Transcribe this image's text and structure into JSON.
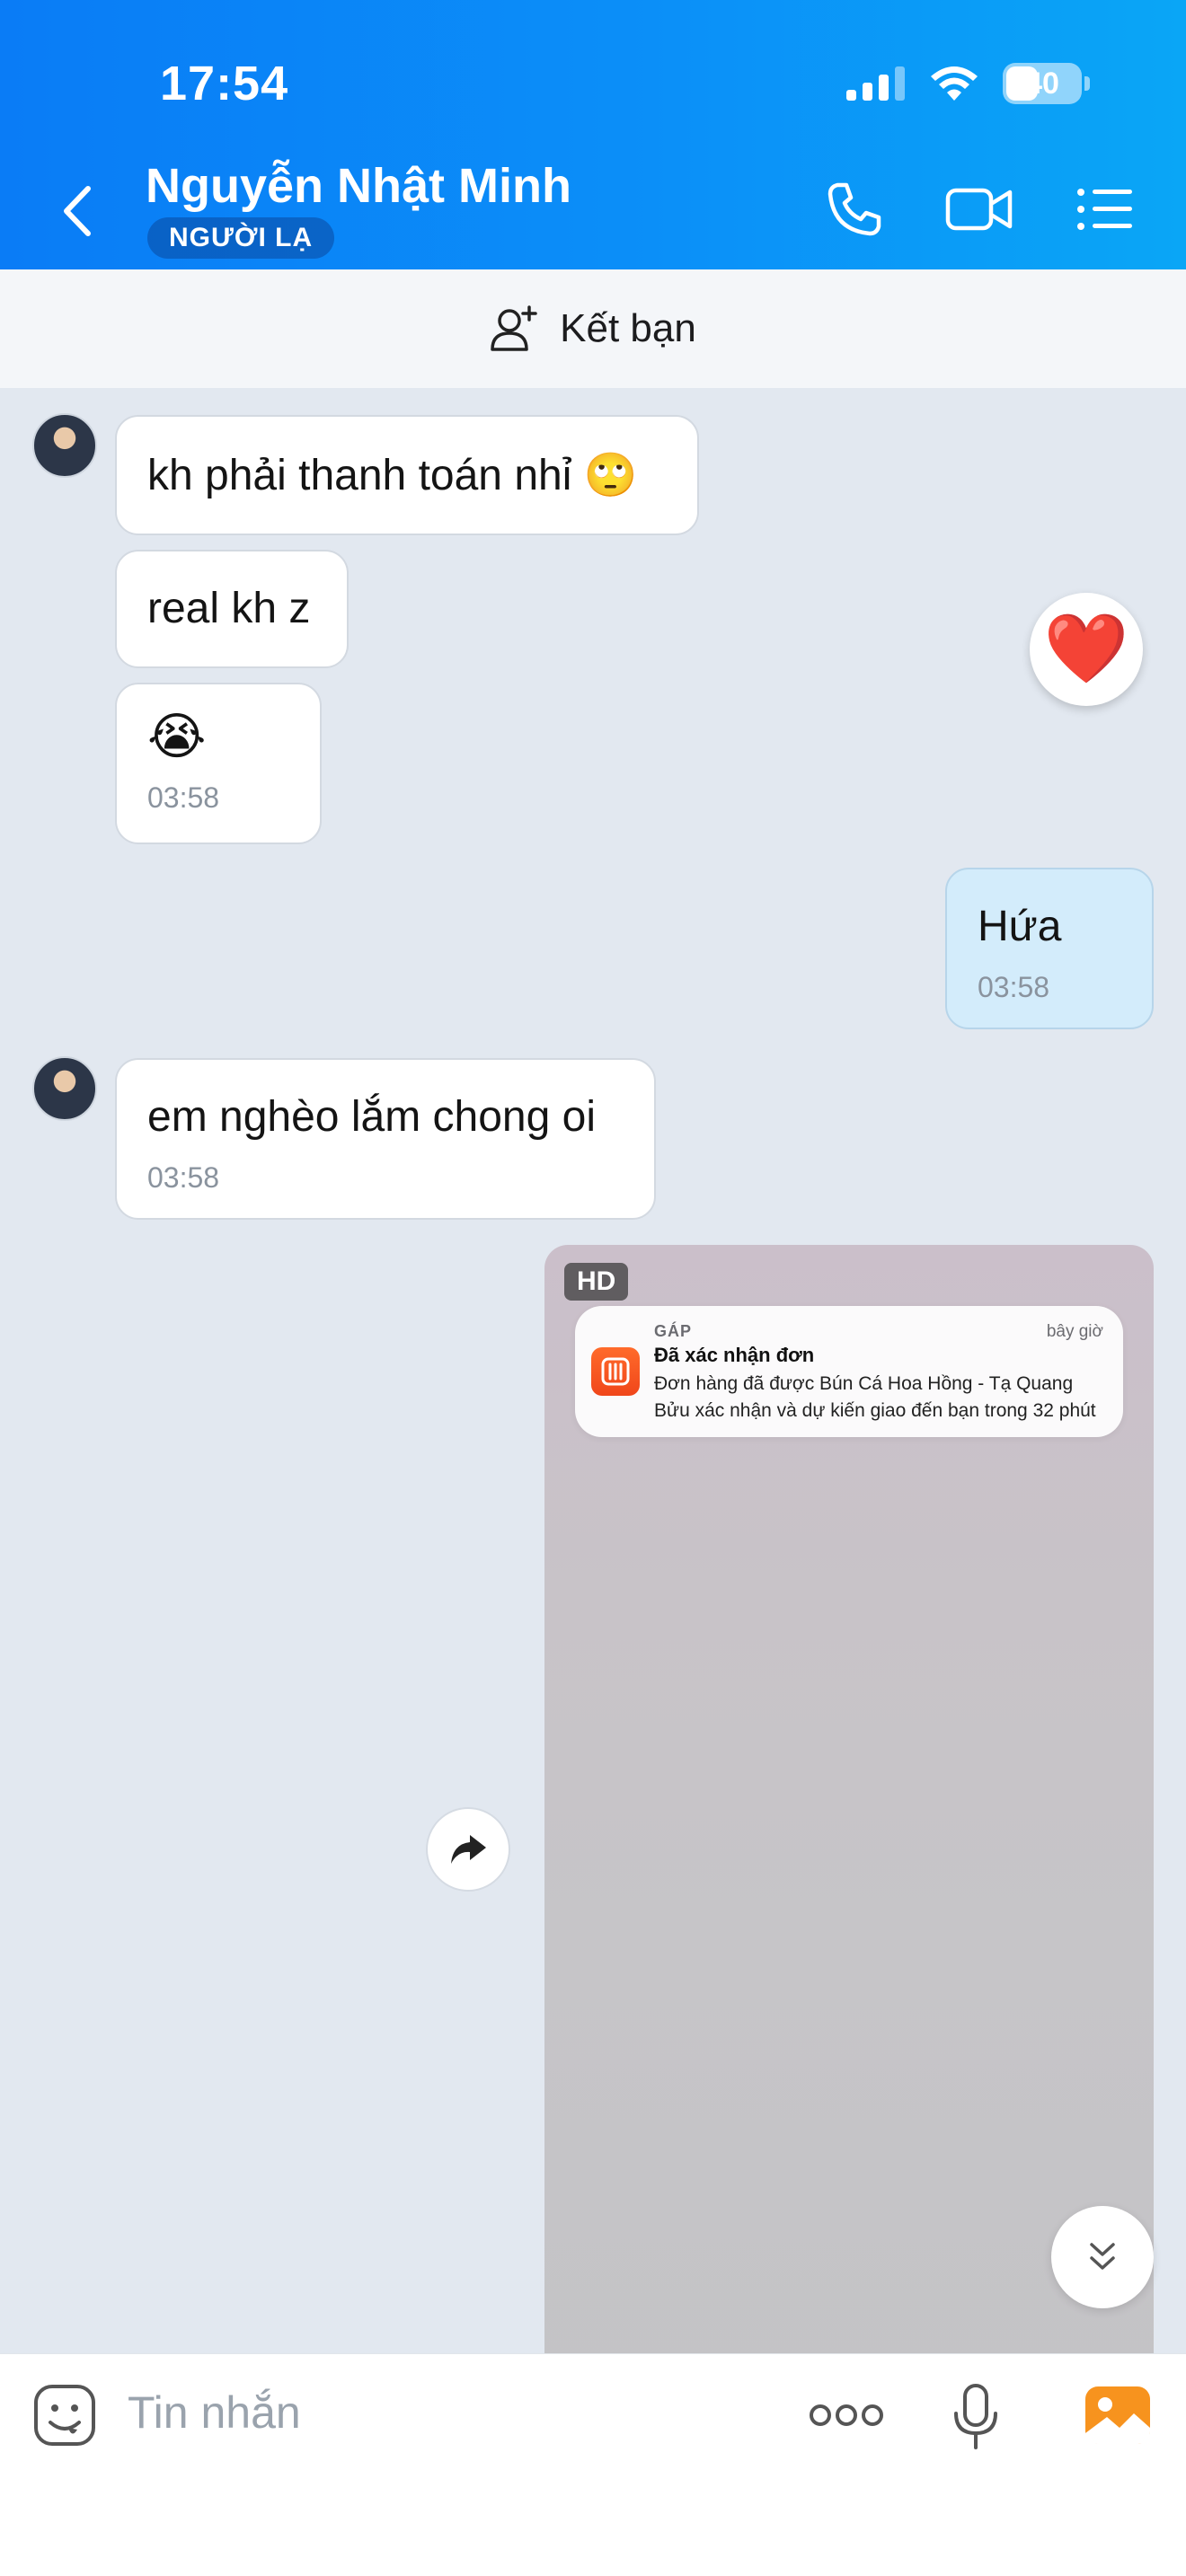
{
  "status_bar": {
    "time": "17:54",
    "battery": "40"
  },
  "header": {
    "name": "Nguyễn Nhật Minh",
    "badge": "NGƯỜI LẠ"
  },
  "friend_bar": {
    "label": "Kết bạn"
  },
  "messages": [
    {
      "text": "kh phải thanh toán nhỉ 🙄",
      "time": ""
    },
    {
      "text": "real kh z",
      "time": ""
    },
    {
      "text": "😭",
      "time": "03:58"
    },
    {
      "text": "Hứa",
      "time": "03:58"
    },
    {
      "text": "em nghèo lắm chong oi",
      "time": "03:58"
    }
  ],
  "reaction": "❤️",
  "image_message": {
    "hd_label": "HD",
    "notification": {
      "app": "GÁP",
      "when": "bây giờ",
      "title": "Đã xác nhận đơn",
      "body": "Đơn hàng đã được Bún Cá Hoa Hồng - Tạ Quang Bửu xác nhận và dự kiến giao đến bạn trong 32 phút"
    }
  },
  "input": {
    "placeholder": "Tin nhắn"
  },
  "colors": {
    "header_start": "#0a7cf6",
    "header_end": "#0aa6f6",
    "mine_bubble": "#d3ecfb",
    "chat_bg": "#e2e8f0"
  }
}
